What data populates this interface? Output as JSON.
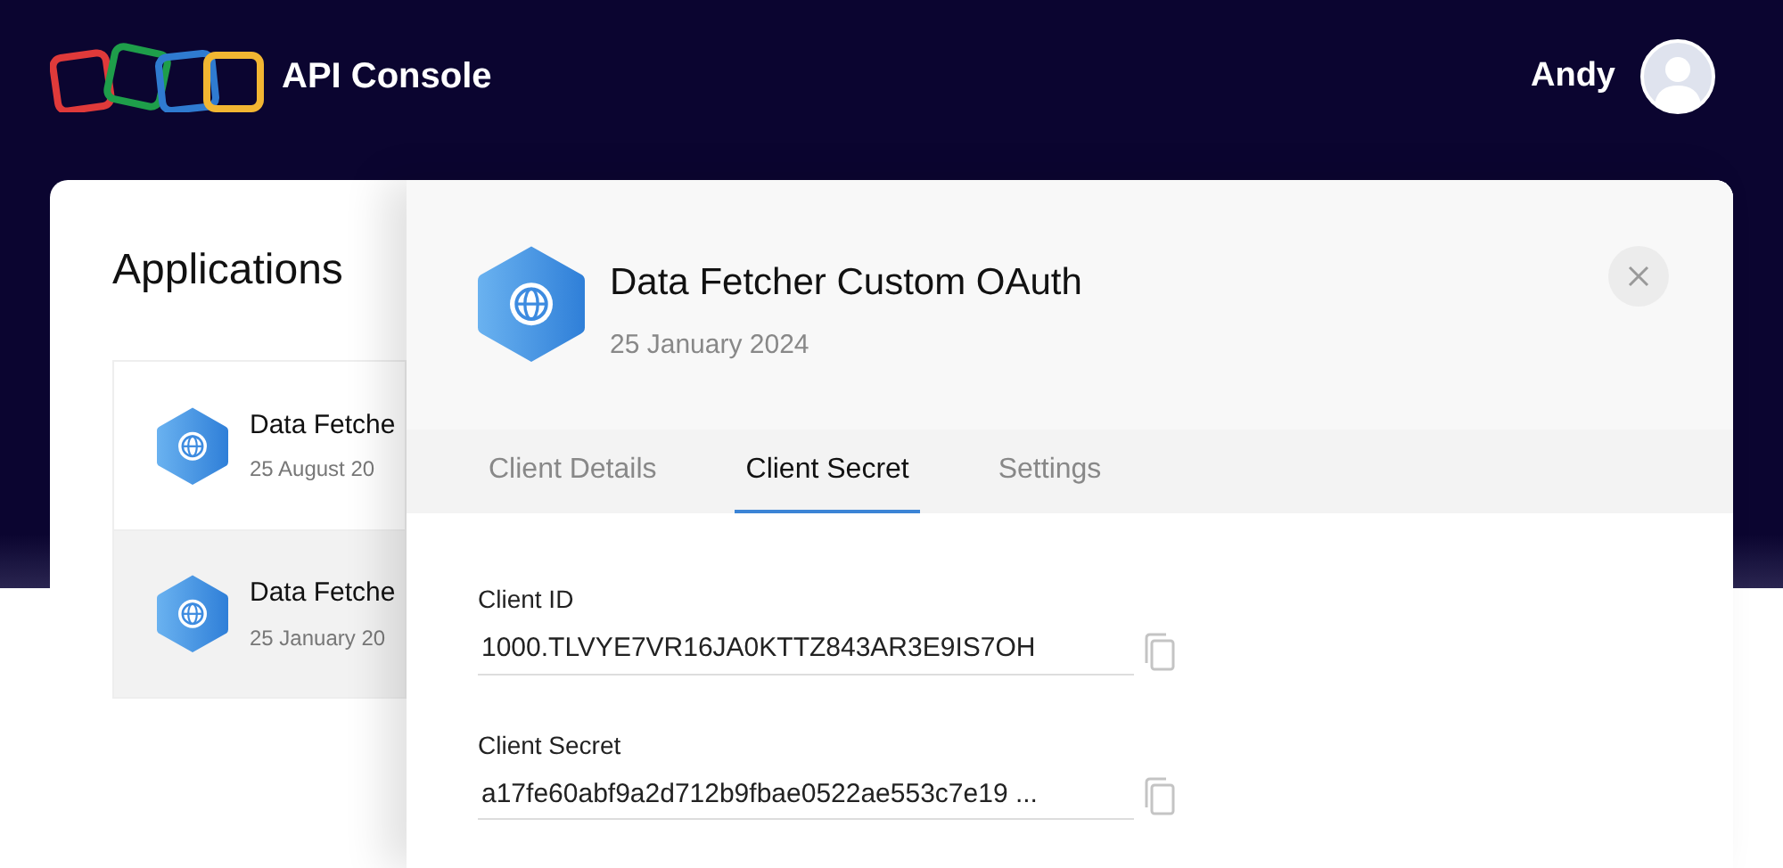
{
  "header": {
    "title": "API Console",
    "user": "Andy"
  },
  "applications": {
    "title": "Applications",
    "items": [
      {
        "name": "Data Fetche",
        "date": "25 August 20",
        "selected": false
      },
      {
        "name": "Data Fetche",
        "date": "25 January 20",
        "selected": true
      }
    ]
  },
  "detail": {
    "name": "Data Fetcher Custom OAuth",
    "date": "25 January 2024",
    "tabs": [
      {
        "label": "Client Details",
        "selected": false
      },
      {
        "label": "Client Secret",
        "selected": true
      },
      {
        "label": "Settings",
        "selected": false
      }
    ],
    "fields": [
      {
        "label": "Client ID",
        "value": "1000.TLVYE7VR16JA0KTTZ843AR3E9IS7OH"
      },
      {
        "label": "Client Secret",
        "value": "a17fe60abf9a2d712b9fbae0522ae553c7e19 ..."
      }
    ]
  }
}
